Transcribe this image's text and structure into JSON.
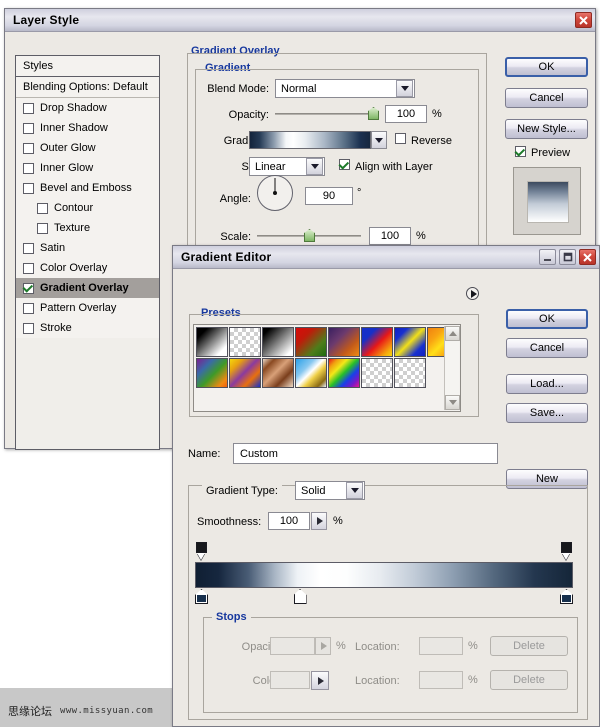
{
  "desktop": {
    "watermark_cn": "思缘论坛",
    "watermark_url": "www.missyuan.com"
  },
  "layer_style": {
    "title": "Layer Style",
    "close_label": "✕",
    "styles_panel": {
      "header": "Styles",
      "blending_options": "Blending Options: Default",
      "items": [
        {
          "label": "Drop Shadow",
          "checked": false,
          "indent": false
        },
        {
          "label": "Inner Shadow",
          "checked": false,
          "indent": false
        },
        {
          "label": "Outer Glow",
          "checked": false,
          "indent": false
        },
        {
          "label": "Inner Glow",
          "checked": false,
          "indent": false
        },
        {
          "label": "Bevel and Emboss",
          "checked": false,
          "indent": false
        },
        {
          "label": "Contour",
          "checked": false,
          "indent": true
        },
        {
          "label": "Texture",
          "checked": false,
          "indent": true
        },
        {
          "label": "Satin",
          "checked": false,
          "indent": false
        },
        {
          "label": "Color Overlay",
          "checked": false,
          "indent": false
        },
        {
          "label": "Gradient Overlay",
          "checked": true,
          "indent": false,
          "selected": true
        },
        {
          "label": "Pattern Overlay",
          "checked": false,
          "indent": false
        },
        {
          "label": "Stroke",
          "checked": false,
          "indent": false
        }
      ]
    },
    "gradient_overlay": {
      "section_title": "Gradient Overlay",
      "group_title": "Gradient",
      "blend_mode_label": "Blend Mode:",
      "blend_mode_value": "Normal",
      "opacity_label": "Opacity:",
      "opacity_value": "100",
      "opacity_unit": "%",
      "gradient_label": "Gradient:",
      "reverse_label": "Reverse",
      "reverse_checked": false,
      "style_label": "Style:",
      "style_value": "Linear",
      "align_label": "Align with Layer",
      "align_checked": true,
      "angle_label": "Angle:",
      "angle_value": "90",
      "angle_unit": "°",
      "scale_label": "Scale:",
      "scale_value": "100",
      "scale_unit": "%"
    },
    "buttons": {
      "ok": "OK",
      "cancel": "Cancel",
      "new_style": "New Style...",
      "preview_label": "Preview",
      "preview_checked": true
    }
  },
  "gradient_editor": {
    "title": "Gradient Editor",
    "minimize_label": "_",
    "maximize_label": "❐",
    "close_label": "✕",
    "presets": {
      "title": "Presets",
      "swatches": [
        {
          "name": "foreground-to-background",
          "css": "linear-gradient(135deg,#000000 0%,#000000 18%,#ffffff 82%,#ffffff 100%)"
        },
        {
          "name": "foreground-to-transparent",
          "css": "linear-gradient(135deg,#000000 0%,#000000 15%,rgba(0,0,0,0) 85%)",
          "checker": true
        },
        {
          "name": "black-white",
          "css": "linear-gradient(135deg,#000000 0%,#000000 12%,#ffffff 88%,#ffffff 100%)"
        },
        {
          "name": "red-green",
          "css": "linear-gradient(135deg,#d80b0b 0%,#c01a0a 30%,#4e7d1a 70%,#1f6b12 100%)"
        },
        {
          "name": "violet-orange",
          "css": "linear-gradient(135deg,#3b2060 0%,#6b3a6e 35%,#c25a1a 70%,#f08a12 100%)"
        },
        {
          "name": "blue-red-yellow",
          "css": "linear-gradient(135deg,#1730c8 0%,#1730c8 25%,#e81818 55%,#f5a80d 85%,#f5d80d 100%)"
        },
        {
          "name": "blue-yellow-blue",
          "css": "linear-gradient(135deg,#1020c0 0%,#1730d0 22%,#f2e018 50%,#1730d0 78%,#1020c0 100%)"
        },
        {
          "name": "orange-yellow-orange",
          "css": "linear-gradient(135deg,#f08210 0%,#f8a412 28%,#ffe018 52%,#f8a412 76%,#f08210 100%)"
        },
        {
          "name": "violet-green-orange",
          "css": "linear-gradient(135deg,#7b2090 0%,#3a6aa8 28%,#3e9a28 55%,#f08a12 85%,#f0600e 100%)"
        },
        {
          "name": "yellow-violet-orange-blue",
          "css": "linear-gradient(135deg,#f5d80d 0%,#e8a010 22%,#8a3aa0 48%,#e8700e 72%,#1730c8 100%)"
        },
        {
          "name": "copper",
          "css": "linear-gradient(135deg,#e8d8c8 0%,#8a4a22 20%,#d8a078 45%,#7a3e1c 70%,#f0ddc8 100%)"
        },
        {
          "name": "chrome",
          "css": "linear-gradient(135deg,#2aa0e8 0%,#88c8f0 32%,#ffffff 48%,#f0d048 62%,#8a6a14 85%,#e8f2fa 100%)"
        },
        {
          "name": "spectrum",
          "css": "linear-gradient(135deg,#e81818 0%,#f0a010 16%,#f2e818 32%,#28c028 50%,#1840e8 68%,#7818c8 85%,#e81890 100%)"
        },
        {
          "name": "transparent-rainbow",
          "css": "linear-gradient(135deg,rgba(232,24,24,0) 0%,#e81818 18%,#f0e018 36%,#28c028 52%,#1840e8 70%,rgba(24,64,232,0) 100%)",
          "checker": true
        },
        {
          "name": "transparent-stripes",
          "css": "repeating-linear-gradient(135deg,#111111 0px,#111111 7px,rgba(255,255,255,0) 7px,rgba(255,255,255,0) 14px)",
          "checker": true
        }
      ]
    },
    "buttons": {
      "ok": "OK",
      "cancel": "Cancel",
      "load": "Load...",
      "save": "Save...",
      "new": "New"
    },
    "name_label": "Name:",
    "name_value": "Custom",
    "gradient_type_label": "Gradient Type:",
    "gradient_type_value": "Solid",
    "smoothness_label": "Smoothness:",
    "smoothness_value": "100",
    "smoothness_unit": "%",
    "stops": {
      "title": "Stops",
      "opacity_label": "Opacity:",
      "opacity_value": "",
      "opacity_unit": "%",
      "color_label": "Color:",
      "location_label_1": "Location:",
      "location_value_1": "",
      "location_unit_1": "%",
      "location_label_2": "Location:",
      "location_value_2": "",
      "location_unit_2": "%",
      "delete_label_1": "Delete",
      "delete_label_2": "Delete"
    },
    "gradient_bar": {
      "stops_top": [
        {
          "name": "opacity-stop-left",
          "pos_pct": 0
        },
        {
          "name": "opacity-stop-right",
          "pos_pct": 100
        }
      ],
      "stops_bottom": [
        {
          "name": "color-stop-dark-left",
          "pos_pct": 0,
          "color": "#17304d"
        },
        {
          "name": "color-stop-white-mid",
          "pos_pct": 27,
          "color": "#ffffff"
        },
        {
          "name": "color-stop-dark-right",
          "pos_pct": 100,
          "color": "#17304d"
        }
      ]
    }
  }
}
